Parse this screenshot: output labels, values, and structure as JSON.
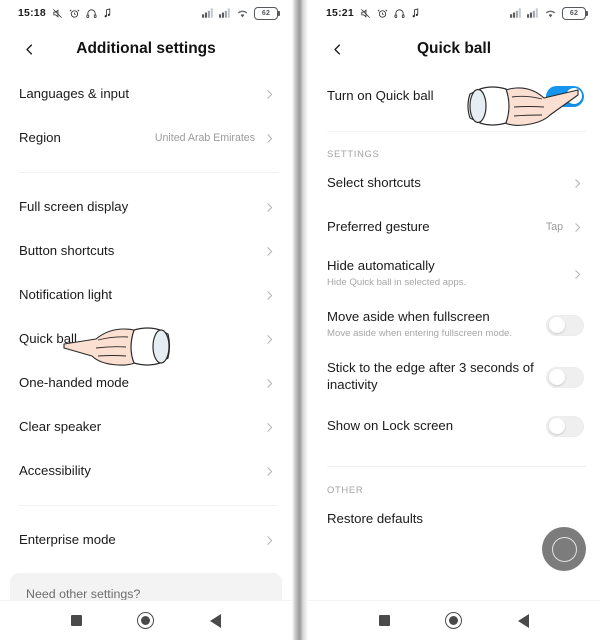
{
  "left_screen": {
    "status_bar": {
      "time": "15:18",
      "left_icons": [
        "mute-icon",
        "alarm-icon",
        "headphones-icon",
        "music-note-icon"
      ],
      "right_icons": [
        "signal-1-icon",
        "signal-2-icon",
        "wifi-icon"
      ],
      "battery_level": "62"
    },
    "app_bar": {
      "back_icon": "chevron-left-icon",
      "title": "Additional settings"
    },
    "groups": [
      {
        "items": [
          {
            "title": "Languages & input",
            "value": "",
            "chevron": true
          },
          {
            "title": "Region",
            "value": "United Arab Emirates",
            "chevron": true
          }
        ]
      },
      {
        "items": [
          {
            "title": "Full screen display",
            "value": "",
            "chevron": true
          },
          {
            "title": "Button shortcuts",
            "value": "",
            "chevron": true
          },
          {
            "title": "Notification light",
            "value": "",
            "chevron": true
          },
          {
            "title": "Quick ball",
            "value": "",
            "chevron": true
          },
          {
            "title": "One-handed mode",
            "value": "",
            "chevron": true
          },
          {
            "title": "Clear speaker",
            "value": "",
            "chevron": true
          },
          {
            "title": "Accessibility",
            "value": "",
            "chevron": true
          }
        ]
      },
      {
        "items": [
          {
            "title": "Enterprise mode",
            "value": "",
            "chevron": true
          }
        ]
      }
    ],
    "promo": {
      "text": "Need other settings?"
    },
    "hand_cursor": "pointing-hand-icon",
    "nav_bar": {
      "recents": "recents-square-icon",
      "home": "home-circle-icon",
      "back": "back-triangle-icon"
    }
  },
  "right_screen": {
    "status_bar": {
      "time": "15:21",
      "left_icons": [
        "mute-icon",
        "alarm-icon",
        "headphones-icon",
        "music-note-icon"
      ],
      "right_icons": [
        "signal-1-icon",
        "signal-2-icon",
        "wifi-icon"
      ],
      "battery_level": "62"
    },
    "app_bar": {
      "back_icon": "chevron-left-icon",
      "title": "Quick ball"
    },
    "master_toggle": {
      "title": "Turn on Quick ball",
      "state": "on"
    },
    "settings_section": {
      "label": "SETTINGS",
      "items": [
        {
          "title": "Select shortcuts",
          "subtitle": "",
          "value": "",
          "control": "chevron"
        },
        {
          "title": "Preferred gesture",
          "subtitle": "",
          "value": "Tap",
          "control": "chevron"
        },
        {
          "title": "Hide automatically",
          "subtitle": "Hide Quick ball in selected apps.",
          "value": "",
          "control": "chevron"
        },
        {
          "title": "Move aside when fullscreen",
          "subtitle": "Move aside when entering fullscreen mode.",
          "value": "",
          "control": "toggle",
          "state": "off"
        },
        {
          "title": "Stick to the edge after 3 seconds of inactivity",
          "subtitle": "",
          "value": "",
          "control": "toggle",
          "state": "off"
        },
        {
          "title": "Show on Lock screen",
          "subtitle": "",
          "value": "",
          "control": "toggle",
          "state": "off"
        }
      ]
    },
    "other_section": {
      "label": "OTHER",
      "items": [
        {
          "title": "Restore defaults",
          "subtitle": "",
          "value": "",
          "control": "none"
        }
      ]
    },
    "floating_ball": "quick-ball-widget",
    "hand_cursor": "pointing-hand-icon",
    "nav_bar": {
      "recents": "recents-square-icon",
      "home": "home-circle-icon",
      "back": "back-triangle-icon"
    }
  },
  "colors": {
    "toggle_on": "#1595f0",
    "toggle_off": "#efefef",
    "ball": "#7c7c7c",
    "text_primary": "#1a1a1a",
    "text_secondary": "#a6a6a6"
  }
}
